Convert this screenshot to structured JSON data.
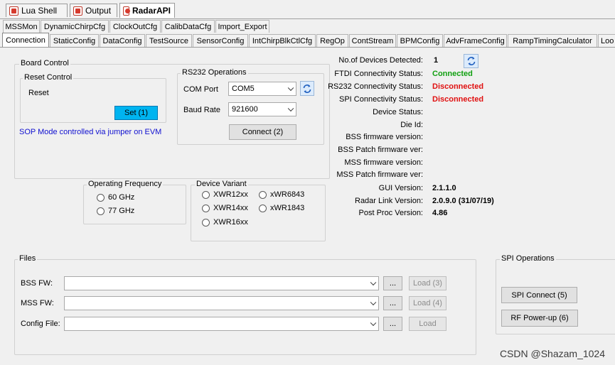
{
  "doc_tabs": [
    {
      "label": "Lua Shell",
      "icon": "lua-shell-icon"
    },
    {
      "label": "Output",
      "icon": "output-icon"
    },
    {
      "label": "RadarAPI",
      "icon": "radar-api-icon"
    }
  ],
  "tabs_row1": [
    "MSSMon",
    "DynamicChirpCfg",
    "ClockOutCfg",
    "CalibDataCfg",
    "Import_Export"
  ],
  "tabs_row2": [
    "Connection",
    "StaticConfig",
    "DataConfig",
    "TestSource",
    "SensorConfig",
    "IntChirpBlkCtlCfg",
    "RegOp",
    "ContStream",
    "BPMConfig",
    "AdvFrameConfig",
    "RampTimingCalculator",
    "Loo"
  ],
  "board_control": {
    "title": "Board Control",
    "reset_control": {
      "title": "Reset Control",
      "reset_label": "Reset",
      "set_button": "Set (1)"
    },
    "sop_note": "SOP Mode controlled via jumper on EVM",
    "rs232": {
      "title": "RS232 Operations",
      "com_port_label": "COM Port",
      "com_port_value": "COM5",
      "baud_rate_label": "Baud Rate",
      "baud_rate_value": "921600",
      "connect_button": "Connect (2)"
    }
  },
  "status": {
    "devices_label": "No.of Devices Detected:",
    "devices_value": "1",
    "rows": [
      {
        "label": "FTDI Connectivity Status:",
        "value": "Connected"
      },
      {
        "label": "RS232 Connectivity Status:",
        "value": "Disconnected"
      },
      {
        "label": "SPI Connectivity Status:",
        "value": "Disconnected"
      },
      {
        "label": "Device Status:",
        "value": ""
      },
      {
        "label": "Die Id:",
        "value": ""
      },
      {
        "label": "BSS firmware version:",
        "value": ""
      },
      {
        "label": "BSS Patch firmware ver:",
        "value": ""
      },
      {
        "label": "MSS firmware version:",
        "value": ""
      },
      {
        "label": "MSS Patch firmware ver:",
        "value": ""
      },
      {
        "label": "GUI Version:",
        "value": "2.1.1.0"
      },
      {
        "label": "Radar Link Version:",
        "value": "2.0.9.0 (31/07/19)"
      },
      {
        "label": "Post Proc Version:",
        "value": "4.86"
      }
    ],
    "colors": {
      "connected": "#11a011",
      "disconnected": "#e01010"
    }
  },
  "operating_frequency": {
    "title": "Operating Frequency",
    "options": [
      "60 GHz",
      "77 GHz"
    ]
  },
  "device_variant": {
    "title": "Device Variant",
    "left": [
      "XWR12xx",
      "XWR14xx",
      "XWR16xx"
    ],
    "right": [
      "xWR6843",
      "xWR1843"
    ]
  },
  "files": {
    "title": "Files",
    "rows": [
      {
        "label": "BSS FW:",
        "value": "",
        "browse": "...",
        "load": "Load (3)"
      },
      {
        "label": "MSS FW:",
        "value": "",
        "browse": "...",
        "load": "Load (4)"
      },
      {
        "label": "Config File:",
        "value": "",
        "browse": "...",
        "load": "Load"
      }
    ]
  },
  "spi_operations": {
    "title": "SPI Operations",
    "spi_connect": "SPI Connect (5)",
    "rf_powerup": "RF Power-up (6)"
  },
  "watermark": "CSDN @Shazam_1024"
}
